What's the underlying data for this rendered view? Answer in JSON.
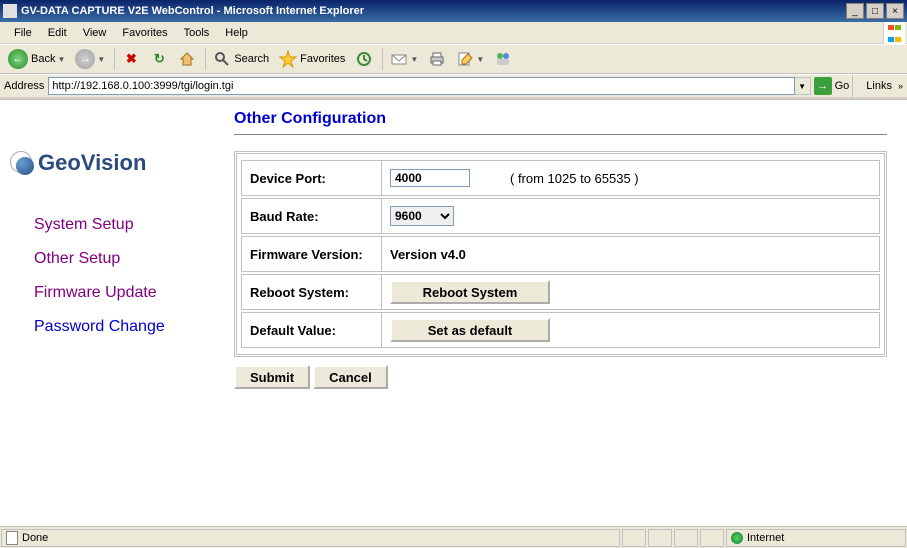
{
  "window": {
    "title": "GV-DATA CAPTURE V2E WebControl - Microsoft Internet Explorer"
  },
  "menu": {
    "file": "File",
    "edit": "Edit",
    "view": "View",
    "favorites": "Favorites",
    "tools": "Tools",
    "help": "Help"
  },
  "toolbar": {
    "back": "Back",
    "search": "Search",
    "favorites": "Favorites"
  },
  "address": {
    "label": "Address",
    "value": "http://192.168.0.100:3999/tgi/login.tgi",
    "go": "Go",
    "links": "Links"
  },
  "brand": {
    "name": "GeoVision"
  },
  "sidebar": {
    "items": [
      {
        "label": "System Setup",
        "color": "#800080"
      },
      {
        "label": "Other Setup",
        "color": "#800080"
      },
      {
        "label": "Firmware Update",
        "color": "#800080"
      },
      {
        "label": "Password Change",
        "color": "#0000cc"
      }
    ]
  },
  "page": {
    "title": "Other Configuration",
    "rows": {
      "device_port": {
        "label": "Device Port:",
        "value": "4000",
        "hint": "( from 1025 to 65535 )"
      },
      "baud_rate": {
        "label": "Baud Rate:",
        "value": "9600",
        "options": [
          "9600"
        ]
      },
      "firmware": {
        "label": "Firmware Version:",
        "value": "Version v4.0"
      },
      "reboot": {
        "label": "Reboot System:",
        "button": "Reboot System"
      },
      "default_v": {
        "label": "Default Value:",
        "button": "Set as default"
      }
    },
    "submit": "Submit",
    "cancel": "Cancel"
  },
  "status": {
    "text": "Done",
    "zone": "Internet"
  }
}
